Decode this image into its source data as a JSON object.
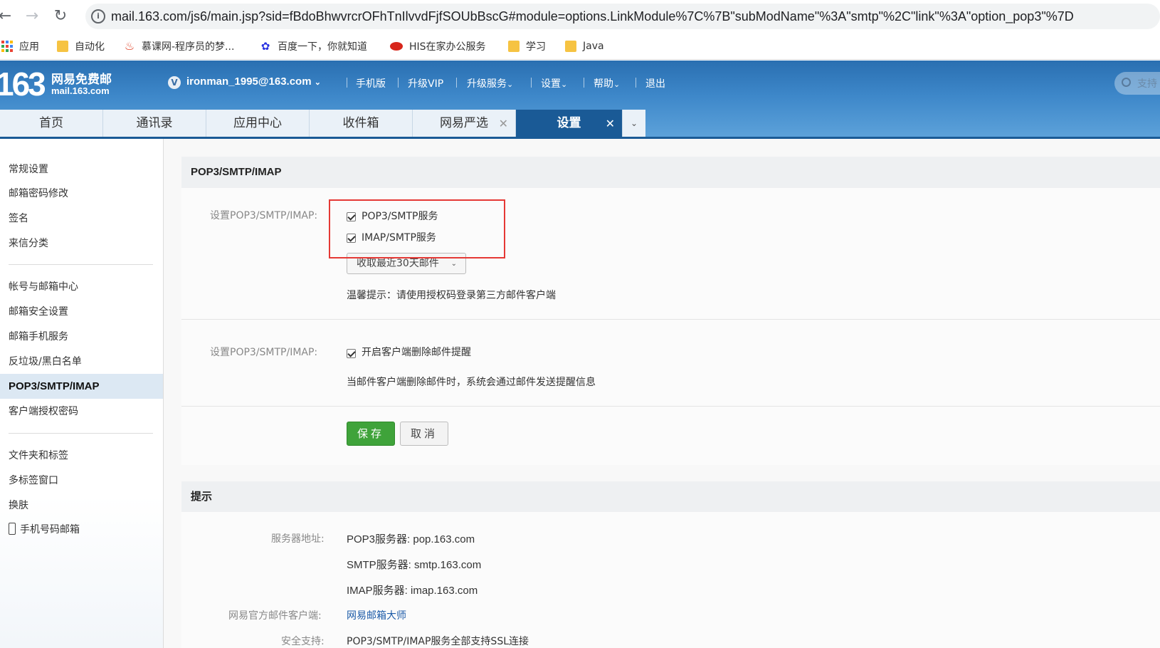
{
  "browser": {
    "url": "mail.163.com/js6/main.jsp?sid=fBdoBhwvrcrOFhTnIlvvdFjfSOUbBscG#module=options.LinkModule%7C%7B\"subModName\"%3A\"smtp\"%2C\"link\"%3A\"option_pop3\"%7D",
    "bookmarks": [
      "应用",
      "自动化",
      "慕课网-程序员的梦...",
      "百度一下，你就知道",
      "HIS在家办公服务",
      "学习",
      "Java"
    ]
  },
  "header": {
    "logo_number": "163",
    "logo_title": "网易免费邮",
    "logo_domain": "mail.163.com",
    "vip_badge": "V",
    "user_email": "ironman_1995@163.com",
    "links": [
      "手机版",
      "升级VIP",
      "升级服务",
      "设置",
      "帮助",
      "退出"
    ],
    "search_placeholder": "支持"
  },
  "tabs": [
    {
      "label": "首页"
    },
    {
      "label": "通讯录"
    },
    {
      "label": "应用中心"
    },
    {
      "label": "收件箱"
    },
    {
      "label": "网易严选"
    },
    {
      "label": "设置"
    }
  ],
  "sidebar": {
    "items": [
      "常规设置",
      "邮箱密码修改",
      "签名",
      "来信分类",
      "帐号与邮箱中心",
      "邮箱安全设置",
      "邮箱手机服务",
      "反垃圾/黑白名单",
      "POP3/SMTP/IMAP",
      "客户端授权密码",
      "文件夹和标签",
      "多标签窗口",
      "换肤",
      "手机号码邮箱"
    ]
  },
  "settings_panel": {
    "title": "POP3/SMTP/IMAP",
    "row1_label": "设置POP3/SMTP/IMAP:",
    "pop3_smtp_label": "POP3/SMTP服务",
    "imap_smtp_label": "IMAP/SMTP服务",
    "fetch_select": "收取最近30天邮件",
    "tip": "温馨提示：请使用授权码登录第三方邮件客户端",
    "row2_label": "设置POP3/SMTP/IMAP:",
    "delete_notice_label": "开启客户端删除邮件提醒",
    "delete_notice_desc": "当邮件客户端删除邮件时，系统会通过邮件发送提醒信息",
    "save": "保存",
    "cancel": "取消"
  },
  "hints_panel": {
    "title": "提示",
    "server_label": "服务器地址:",
    "pop3": "POP3服务器: pop.163.com",
    "smtp": "SMTP服务器: smtp.163.com",
    "imap": "IMAP服务器: imap.163.com",
    "client_label": "网易官方邮件客户端:",
    "client_link": "网易邮箱大师",
    "security_label": "安全支持:",
    "security_value": "POP3/SMTP/IMAP服务全部支持SSL连接"
  },
  "colors": {
    "header_blue": "#2a6fb1",
    "active_tab": "#1a5a96",
    "save_green": "#3fa33a",
    "highlight_red": "#e53935",
    "link_blue": "#1c5ba8"
  }
}
